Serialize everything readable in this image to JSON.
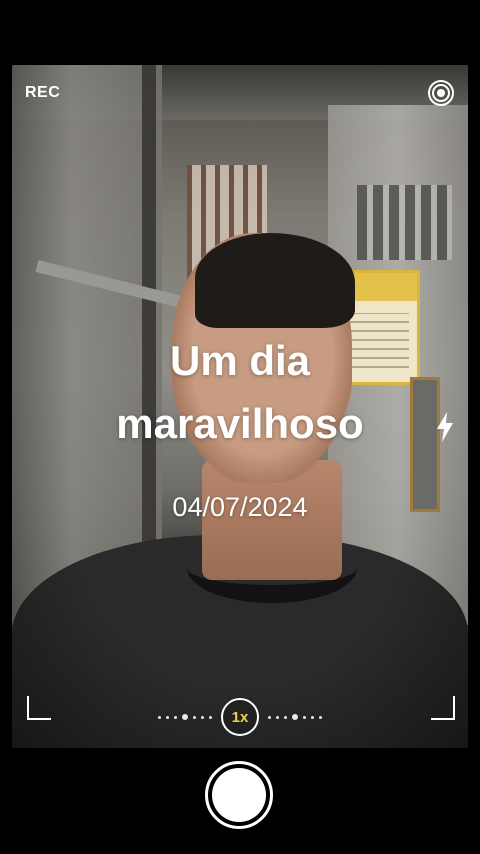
{
  "camera": {
    "rec_label": "REC",
    "overlay_title_line1": "Um dia",
    "overlay_title_line2": "maravilhoso",
    "overlay_date": "04/07/2024",
    "zoom_label": "1x"
  },
  "icons": {
    "settings": "settings-target-icon",
    "flash": "flash-icon"
  },
  "colors": {
    "zoom_text": "#f2d33a",
    "overlay_text": "#ffffff",
    "background": "#000000"
  }
}
